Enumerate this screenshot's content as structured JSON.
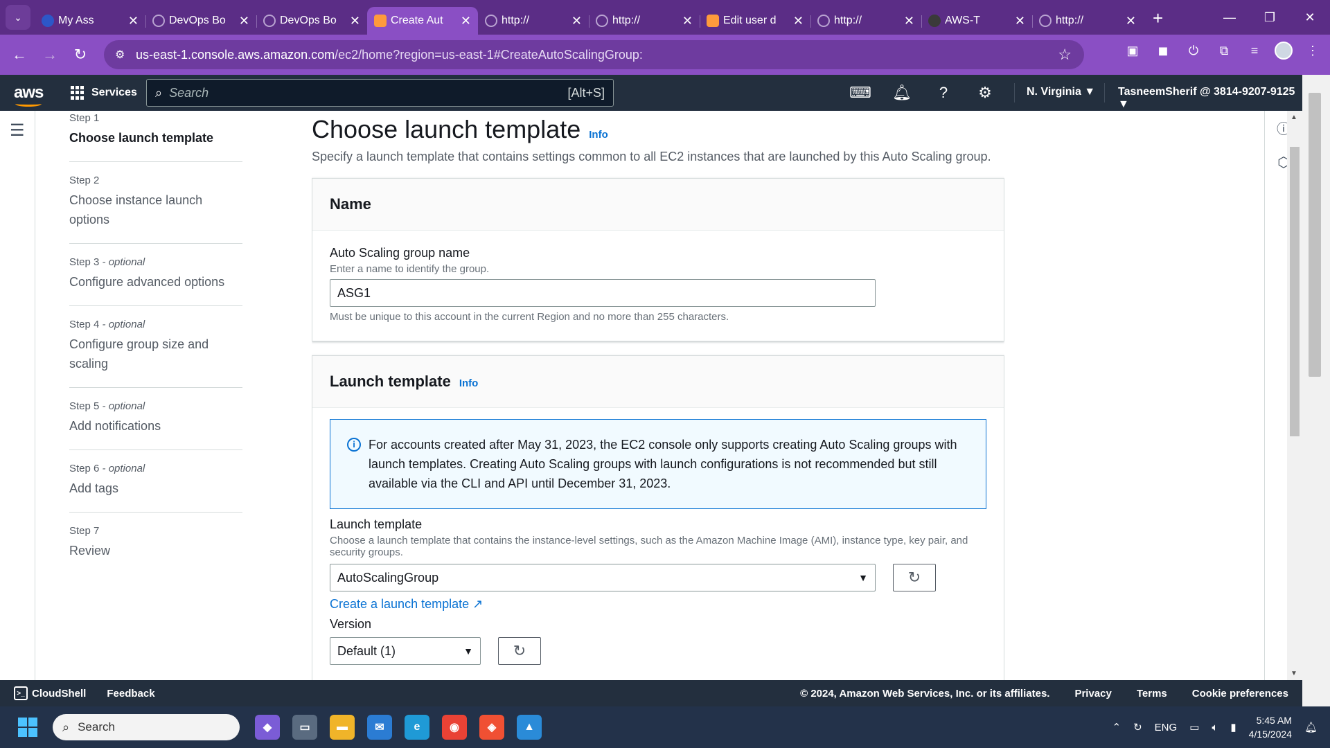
{
  "browser": {
    "tabs": [
      {
        "title": "My Ass",
        "fav": "o",
        "active": false
      },
      {
        "title": "DevOps Bo",
        "fav": "",
        "active": false
      },
      {
        "title": "DevOps Bo",
        "fav": "",
        "active": false
      },
      {
        "title": "Create Aut",
        "fav": "",
        "active": true
      },
      {
        "title": "http://",
        "fav": "",
        "active": false
      },
      {
        "title": "http://",
        "fav": "",
        "active": false
      },
      {
        "title": "Edit user d",
        "fav": "",
        "active": false
      },
      {
        "title": "http://",
        "fav": "",
        "active": false
      },
      {
        "title": "AWS-T",
        "fav": "",
        "active": false
      },
      {
        "title": "http://",
        "fav": "",
        "active": false
      }
    ],
    "url_host": "us-east-1.console.aws.amazon.com",
    "url_path": "/ec2/home?region=us-east-1#CreateAutoScalingGroup:"
  },
  "aws_nav": {
    "logo": "aws",
    "services": "Services",
    "search_placeholder": "Search",
    "search_shortcut": "[Alt+S]",
    "region": "N. Virginia ▼",
    "account": "TasneemSherif @ 3814-9207-9125 ▼"
  },
  "steps": [
    {
      "num": "Step 1",
      "opt": "",
      "label": "Choose launch template",
      "active": true
    },
    {
      "num": "Step 2",
      "opt": "",
      "label": "Choose instance launch options",
      "active": false
    },
    {
      "num": "Step 3",
      "opt": " - optional",
      "label": "Configure advanced options",
      "active": false
    },
    {
      "num": "Step 4",
      "opt": " - optional",
      "label": "Configure group size and scaling",
      "active": false
    },
    {
      "num": "Step 5",
      "opt": " - optional",
      "label": "Add notifications",
      "active": false
    },
    {
      "num": "Step 6",
      "opt": " - optional",
      "label": "Add tags",
      "active": false
    },
    {
      "num": "Step 7",
      "opt": "",
      "label": "Review",
      "active": false
    }
  ],
  "main": {
    "title": "Choose launch template",
    "info": "Info",
    "description": "Specify a launch template that contains settings common to all EC2 instances that are launched by this Auto Scaling group.",
    "name_panel": {
      "heading": "Name",
      "field_label": "Auto Scaling group name",
      "field_desc": "Enter a name to identify the group.",
      "field_value": "ASG1",
      "field_hint": "Must be unique to this account in the current Region and no more than 255 characters."
    },
    "lt_panel": {
      "heading": "Launch template",
      "info": "Info",
      "alert": "For accounts created after May 31, 2023, the EC2 console only supports creating Auto Scaling groups with launch templates. Creating Auto Scaling groups with launch configurations is not recommended but still available via the CLI and API until December 31, 2023.",
      "field_label": "Launch template",
      "field_desc": "Choose a launch template that contains the instance-level settings, such as the Amazon Machine Image (AMI), instance type, key pair, and security groups.",
      "selected": "AutoScalingGroup",
      "create_link": "Create a launch template",
      "version_label": "Version",
      "version_selected": "Default (1)"
    }
  },
  "aws_footer": {
    "cloudshell": "CloudShell",
    "feedback": "Feedback",
    "copyright": "© 2024, Amazon Web Services, Inc. or its affiliates.",
    "privacy": "Privacy",
    "terms": "Terms",
    "cookies": "Cookie preferences"
  },
  "taskbar": {
    "search": "Search",
    "lang": "ENG",
    "time": "5:45 AM",
    "date": "4/15/2024"
  }
}
